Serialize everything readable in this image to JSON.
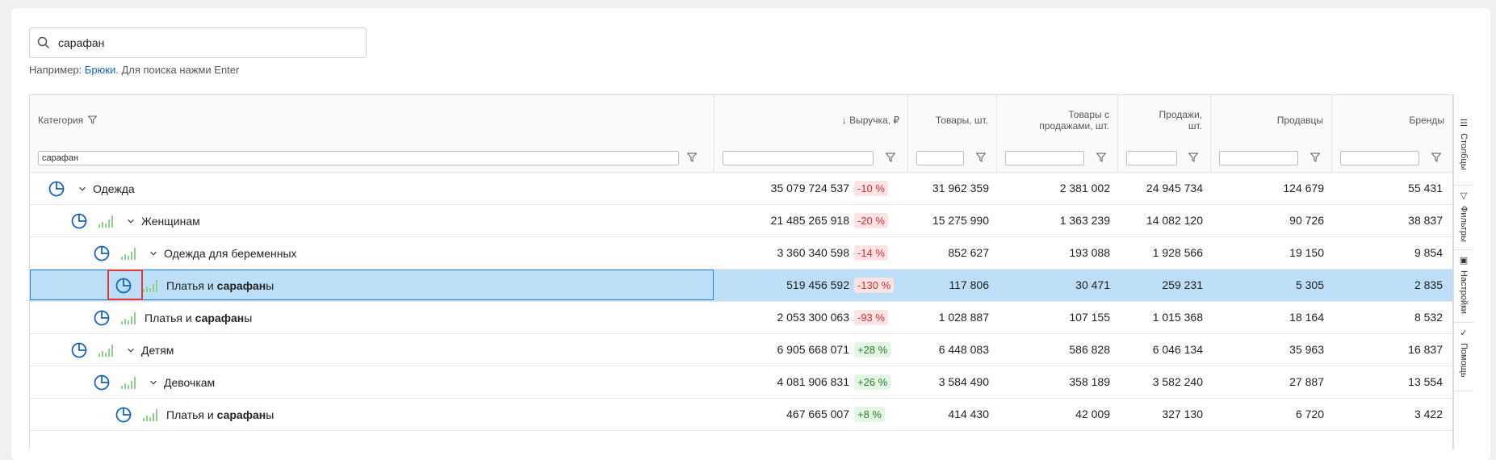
{
  "search": {
    "value": "сарафан",
    "placeholder": ""
  },
  "hint": {
    "prefix": "Например: ",
    "example": "Брюки",
    "suffix": ". Для поиска нажми Enter"
  },
  "columns": {
    "category": "Категория",
    "revenue": "↓ Выручка, ₽",
    "goods": "Товары, шт.",
    "goods_sales_1": "Товары с",
    "goods_sales_2": "продажами, шт.",
    "sales_1": "Продажи,",
    "sales_2": "шт.",
    "sellers": "Продавцы",
    "brands": "Бренды"
  },
  "filters": {
    "category": "сарафан"
  },
  "rows": [
    {
      "name": "Одежда",
      "revenue": "35 079 724 537",
      "change": "-10 %",
      "goods": "31 962 359",
      "goods_sales": "2 381 002",
      "sales": "24 945 734",
      "sellers": "124 679",
      "brands": "55 431"
    },
    {
      "name": "Женщинам",
      "revenue": "21 485 265 918",
      "change": "-20 %",
      "goods": "15 275 990",
      "goods_sales": "1 363 239",
      "sales": "14 082 120",
      "sellers": "90 726",
      "brands": "38 837"
    },
    {
      "name": "Одежда для беременных",
      "revenue": "3 360 340 598",
      "change": "-14 %",
      "goods": "852 627",
      "goods_sales": "193 088",
      "sales": "1 928 566",
      "sellers": "19 150",
      "brands": "9 854"
    },
    {
      "name_pre": "Платья и ",
      "name_bold": "сарафан",
      "name_post": "ы",
      "revenue": "519 456 592",
      "change": "-130 %",
      "goods": "117 806",
      "goods_sales": "30 471",
      "sales": "259 231",
      "sellers": "5 305",
      "brands": "2 835"
    },
    {
      "name_pre": "Платья и ",
      "name_bold": "сарафан",
      "name_post": "ы",
      "revenue": "2 053 300 063",
      "change": "-93 %",
      "goods": "1 028 887",
      "goods_sales": "107 155",
      "sales": "1 015 368",
      "sellers": "18 164",
      "brands": "8 532"
    },
    {
      "name": "Детям",
      "revenue": "6 905 668 071",
      "change": "+28 %",
      "goods": "6 448 083",
      "goods_sales": "586 828",
      "sales": "6 046 134",
      "sellers": "35 963",
      "brands": "16 837"
    },
    {
      "name": "Девочкам",
      "revenue": "4 081 906 831",
      "change": "+26 %",
      "goods": "3 584 490",
      "goods_sales": "358 189",
      "sales": "3 582 240",
      "sellers": "27 887",
      "brands": "13 554"
    },
    {
      "name_pre": "Платья и ",
      "name_bold": "сарафан",
      "name_post": "ы",
      "revenue": "467 665 007",
      "change": "+8 %",
      "goods": "414 430",
      "goods_sales": "42 009",
      "sales": "327 130",
      "sellers": "6 720",
      "brands": "3 422"
    }
  ],
  "side_tabs": {
    "columns": "Столбцы",
    "filters": "Фильтры",
    "settings": "Настройки",
    "help": "Помощь"
  },
  "colors": {
    "accent": "#1565c0",
    "selected_row": "#bcdff7",
    "negative": "#d32f2f",
    "positive": "#2e7d32",
    "bars": "#8fd08f"
  },
  "icons": {
    "search": "search-icon",
    "filter": "funnel-icon",
    "pie": "pie-chart-icon",
    "bars": "bar-chart-icon",
    "expand": "chevron-down-icon"
  }
}
